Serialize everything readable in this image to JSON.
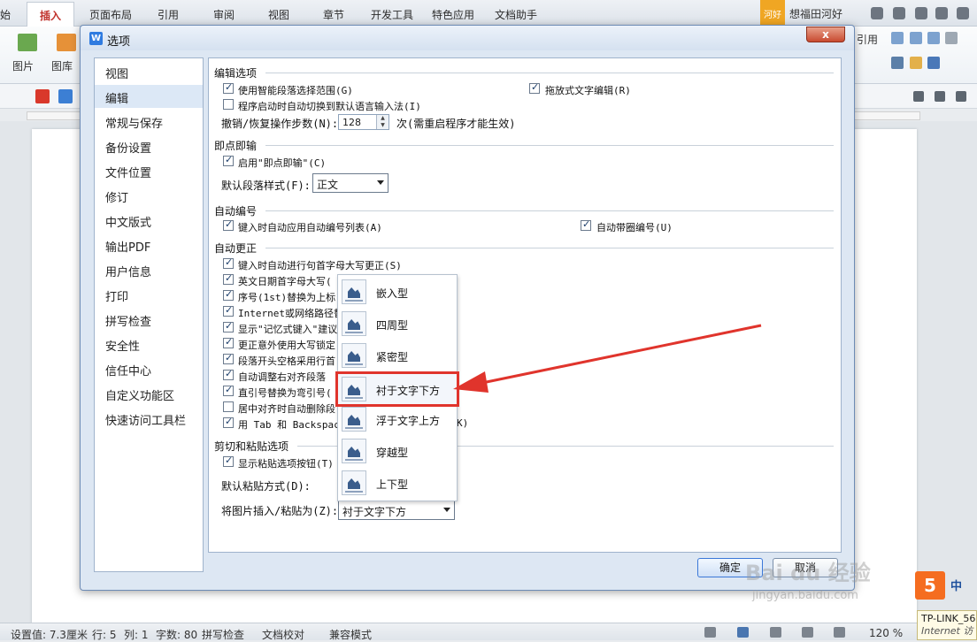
{
  "menubar": {
    "tabs": [
      "始",
      "插入",
      "页面布局",
      "引用",
      "审阅",
      "视图",
      "章节",
      "开发工具",
      "特色应用",
      "文档助手"
    ],
    "active_tab": "插入",
    "badge": "河好",
    "username": "想福田河好"
  },
  "ribbon": {
    "picture_label": "图片",
    "gallery_label": "图库",
    "citation_label": "引用"
  },
  "dialog": {
    "title": "选项",
    "close_label": "x",
    "nav": [
      "视图",
      "编辑",
      "常规与保存",
      "备份设置",
      "文件位置",
      "修订",
      "中文版式",
      "输出PDF",
      "用户信息",
      "打印",
      "拼写检查",
      "安全性",
      "信任中心",
      "自定义功能区",
      "快速访问工具栏"
    ],
    "nav_selected": "编辑",
    "edit_options": {
      "title": "编辑选项",
      "smart_paragraph": "使用智能段落选择范围(G)",
      "drag_drop": "拖放式文字编辑(R)",
      "ime_switch": "程序启动时自动切换到默认语言输入法(I)",
      "undo_label": "撤销/恢复操作步数(N):",
      "undo_value": "128",
      "undo_note": "次(需重启程序才能生效)"
    },
    "instant": {
      "title": "即点即输",
      "enable": "启用\"即点即输\"(C)",
      "default_style_label": "默认段落样式(F):",
      "default_style_value": "正文"
    },
    "autonumber": {
      "title": "自动编号",
      "auto_list": "键入时自动应用自动编号列表(A)",
      "auto_circle": "自动带圈编号(U)"
    },
    "autocorrect": {
      "title": "自动更正",
      "items": [
        "键入时自动进行句首字母大写更正(S)",
        "英文日期首字母大写(",
        "序号(1st)替换为上标",
        "Internet或网络路径替",
        "显示\"记忆式键入\"建议",
        "更正意外使用大写锁定",
        "段落开头空格采用行首",
        "自动调整右对齐段落",
        "直引号替换为弯引号(",
        "居中对齐时自动删除段",
        "用 Tab 和 Backspace"
      ],
      "items_checked": [
        true,
        true,
        true,
        true,
        true,
        true,
        true,
        true,
        true,
        false,
        true
      ],
      "tail": "K)"
    },
    "paste": {
      "title": "剪切和粘贴选项",
      "show_button": "显示粘贴选项按钮(T)",
      "default_paste_label": "默认粘贴方式(D):",
      "image_paste_label": "将图片插入/粘贴为(Z):",
      "image_paste_value": "衬于文字下方"
    },
    "wrap_options": [
      "嵌入型",
      "四周型",
      "紧密型",
      "衬于文字下方",
      "浮于文字上方",
      "穿越型",
      "上下型"
    ],
    "wrap_highlighted": "衬于文字下方",
    "ok_label": "确定",
    "cancel_label": "取消"
  },
  "statusbar": {
    "setting": "设置值: 7.3厘米",
    "row": "行: 5",
    "col": "列: 1",
    "words": "字数: 80",
    "spell": "拼写检查",
    "proof": "文档校对",
    "compat": "兼容模式",
    "zoom": "120 %"
  },
  "overlay": {
    "watermark": "Bai du 经验",
    "watermark_url": "jingyan.baidu.com",
    "ime_logo": "5",
    "ime_zh": "中",
    "tray_line1": "TP-LINK_56",
    "tray_line2": "Internet 访"
  },
  "colors": {
    "annotation_red": "#e0342c",
    "dialog_bg": "#dde7f3",
    "selected_nav": "#dce8f6"
  }
}
